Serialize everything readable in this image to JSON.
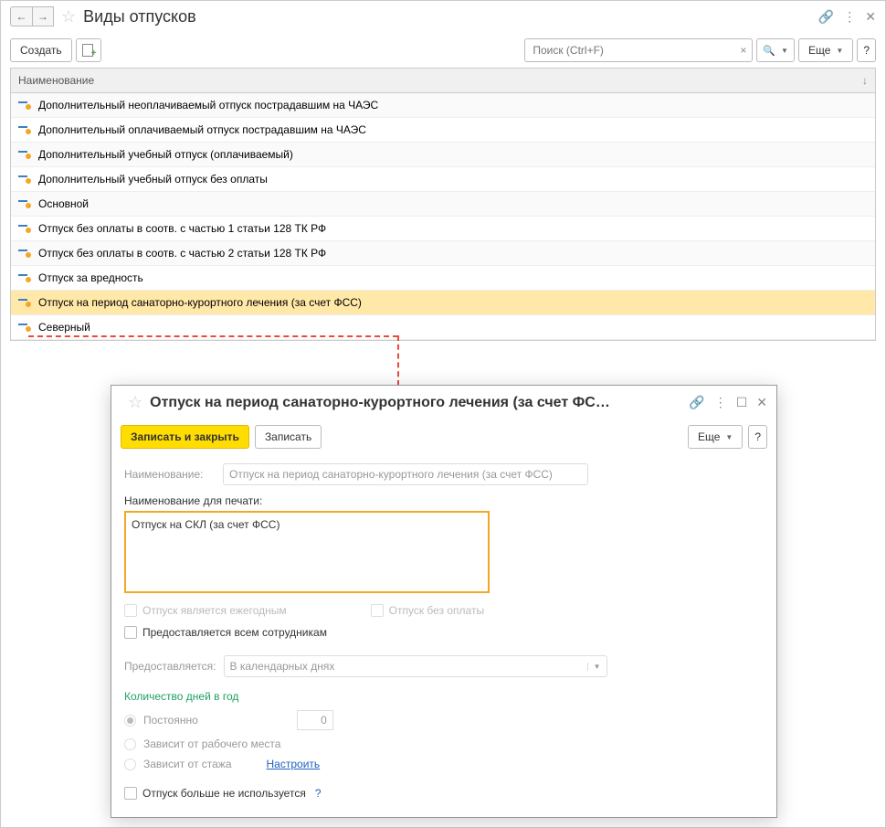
{
  "header": {
    "title": "Виды отпусков"
  },
  "toolbar": {
    "create": "Создать",
    "search_placeholder": "Поиск (Ctrl+F)",
    "more": "Еще",
    "help": "?"
  },
  "list": {
    "header": "Наименование",
    "rows": [
      "Дополнительный неоплачиваемый отпуск пострадавшим на ЧАЭС",
      "Дополнительный оплачиваемый отпуск пострадавшим на ЧАЭС",
      "Дополнительный учебный отпуск (оплачиваемый)",
      "Дополнительный учебный отпуск без оплаты",
      "Основной",
      "Отпуск без оплаты в соотв. с частью 1 статьи 128 ТК РФ",
      "Отпуск без оплаты в соотв. с частью 2 статьи 128 ТК РФ",
      "Отпуск за вредность",
      "Отпуск на период санаторно-курортного лечения (за счет ФСС)",
      "Северный"
    ],
    "selected_index": 8
  },
  "modal": {
    "title": "Отпуск на период санаторно-курортного лечения (за счет ФС…",
    "save_close": "Записать и закрыть",
    "save": "Записать",
    "more": "Еще",
    "help": "?",
    "name_label": "Наименование:",
    "name_value": "Отпуск на период санаторно-курортного лечения (за счет ФСС)",
    "print_label": "Наименование для печати:",
    "print_value": "Отпуск на СКЛ (за счет ФСС)",
    "cb_annual": "Отпуск является ежегодным",
    "cb_unpaid": "Отпуск без оплаты",
    "cb_all_emp": "Предоставляется всем сотрудникам",
    "provided_label": "Предоставляется:",
    "provided_value": "В календарных днях",
    "days_section": "Количество дней в год",
    "r_const": "Постоянно",
    "r_const_val": "0",
    "r_workplace": "Зависит от рабочего места",
    "r_tenure": "Зависит от стажа",
    "configure": "Настроить",
    "cb_not_used": "Отпуск больше не используется"
  }
}
